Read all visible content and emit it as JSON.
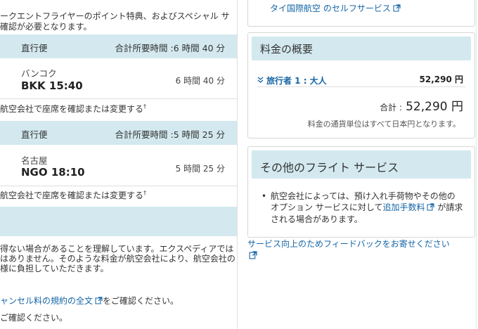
{
  "intro": {
    "line1": "ークエントフライヤーのポイント特典、およびスペシャル サ",
    "line2": "確認が必要となります。"
  },
  "segments": [
    {
      "type": "直行便",
      "total_duration": "合計所要時間 :6 時間 40 分",
      "city": "バンコク",
      "time": "BKK 15:40",
      "duration": "6 時間 40 分",
      "seat_note": "航空会社で座席を確認または変更する",
      "seat_mark": "†"
    },
    {
      "type": "直行便",
      "total_duration": "合計所要時間 :5 時間 25 分",
      "city": "名古屋",
      "time": "NGO 18:10",
      "duration": "5 時間 25 分",
      "seat_note": "航空会社で座席を確認または変更する",
      "seat_mark": "†"
    }
  ],
  "terms": {
    "line1": "得ない場合があることを理解しています。エクスペディアでは",
    "line2": "はありません。そのような料金が航空会社により、航空会社の",
    "line3": "様に負担していただきます。",
    "cancel_link": "ャンセル料の規約の全文",
    "cancel_suffix": "をご確認ください。",
    "last_line": "ご確認ください。"
  },
  "right": {
    "self_service_link": "タイ国際航空 のセルフサービス",
    "price_summary": {
      "title": "料金の概要",
      "traveler_label": "旅行者 1 : 大人",
      "traveler_price": "52,290 円",
      "total_label": "合計 :",
      "total_value": "52,290 円",
      "currency_note": "料金の通貨単位はすべて日本円となります。"
    },
    "other_services": {
      "title": "その他のフライト サービス",
      "text_before": "航空会社によっては、預け入れ手荷物やその他の オプション サービスに対して",
      "fee_link": "追加手数料",
      "text_after": "が請求 される場合があります。"
    },
    "feedback_link": "サービス向上のためフィードバックをお寄せください"
  },
  "colors": {
    "band": "#d3e9ef",
    "link": "#1565a6",
    "border": "#d6d6d6"
  }
}
